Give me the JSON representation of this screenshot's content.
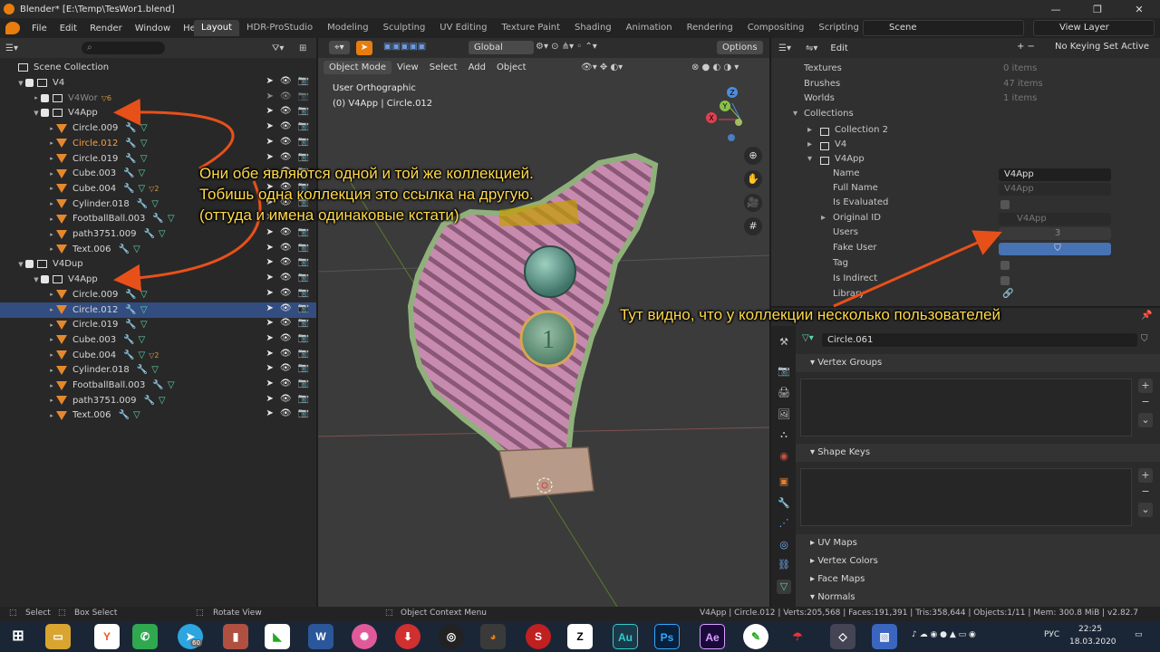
{
  "window": {
    "title": "Blender* [E:\\Temp\\TesWor1.blend]",
    "minimize": "—",
    "maximize": "❐",
    "close": "✕"
  },
  "menu": {
    "items": [
      "File",
      "Edit",
      "Render",
      "Window",
      "Help"
    ],
    "workspace_tabs": [
      "Layout",
      "HDR-ProStudio",
      "Modeling",
      "Sculpting",
      "UV Editing",
      "Texture Paint",
      "Shading",
      "Animation",
      "Rendering",
      "Compositing",
      "Scripting"
    ],
    "active_tab": "Layout",
    "scene": "Scene",
    "view_layer": "View Layer"
  },
  "outliner": {
    "root": "Scene Collection",
    "rows": [
      {
        "label": "V4",
        "depth": 0,
        "kind": "collection",
        "arrow": "▼"
      },
      {
        "label": "V4Wor",
        "depth": 1,
        "kind": "collection",
        "arrow": "▸",
        "dim": true,
        "badge": "6"
      },
      {
        "label": "V4App",
        "depth": 1,
        "kind": "collection",
        "arrow": "▼"
      },
      {
        "label": "Circle.009",
        "depth": 2,
        "kind": "object"
      },
      {
        "label": "Circle.012",
        "depth": 2,
        "kind": "object",
        "active": true
      },
      {
        "label": "Circle.019",
        "depth": 2,
        "kind": "object"
      },
      {
        "label": "Cube.003",
        "depth": 2,
        "kind": "object"
      },
      {
        "label": "Cube.004",
        "depth": 2,
        "kind": "object",
        "badge": "2"
      },
      {
        "label": "Cylinder.018",
        "depth": 2,
        "kind": "object"
      },
      {
        "label": "FootballBall.003",
        "depth": 2,
        "kind": "object"
      },
      {
        "label": "path3751.009",
        "depth": 2,
        "kind": "object"
      },
      {
        "label": "Text.006",
        "depth": 2,
        "kind": "object"
      },
      {
        "label": "V4Dup",
        "depth": 0,
        "kind": "collection",
        "arrow": "▼"
      },
      {
        "label": "V4App",
        "depth": 1,
        "kind": "collection",
        "arrow": "▼"
      },
      {
        "label": "Circle.009",
        "depth": 2,
        "kind": "object"
      },
      {
        "label": "Circle.012",
        "depth": 2,
        "kind": "object",
        "selected": true
      },
      {
        "label": "Circle.019",
        "depth": 2,
        "kind": "object"
      },
      {
        "label": "Cube.003",
        "depth": 2,
        "kind": "object"
      },
      {
        "label": "Cube.004",
        "depth": 2,
        "kind": "object",
        "badge": "2"
      },
      {
        "label": "Cylinder.018",
        "depth": 2,
        "kind": "object"
      },
      {
        "label": "FootballBall.003",
        "depth": 2,
        "kind": "object"
      },
      {
        "label": "path3751.009",
        "depth": 2,
        "kind": "object"
      },
      {
        "label": "Text.006",
        "depth": 2,
        "kind": "object"
      }
    ]
  },
  "viewport": {
    "transform": "Global",
    "options": "Options",
    "mode": "Object Mode",
    "menus": [
      "View",
      "Select",
      "Add",
      "Object"
    ],
    "view_name": "User Orthographic",
    "context": "(0) V4App | Circle.012",
    "axis_x": "X",
    "axis_y": "Y",
    "axis_z": "Z"
  },
  "props_top": {
    "edit": "Edit",
    "keying": "No Keying Set Active",
    "rows": [
      {
        "key": "Textures",
        "value": "0 items"
      },
      {
        "key": "Brushes",
        "value": "47 items"
      },
      {
        "key": "Worlds",
        "value": "1 items"
      },
      {
        "key": "Collections",
        "value": ""
      }
    ],
    "children": [
      "Collection 2",
      "V4",
      "V4App"
    ],
    "fields": {
      "name_label": "Name",
      "name_value": "V4App",
      "full_name_label": "Full Name",
      "full_name_value": "V4App",
      "evaluated_label": "Is Evaluated",
      "original_label": "Original ID",
      "original_value": "V4App",
      "users_label": "Users",
      "users_value": "3",
      "fake_label": "Fake User",
      "tag_label": "Tag",
      "indirect_label": "Is Indirect",
      "library_label": "Library"
    }
  },
  "props_bot": {
    "object_name": "Circle.061",
    "panels": {
      "vertex_groups": "Vertex Groups",
      "shape_keys": "Shape Keys",
      "uv_maps": "UV Maps",
      "vertex_colors": "Vertex Colors",
      "face_maps": "Face Maps",
      "normals": "Normals"
    }
  },
  "status": {
    "select": "Select",
    "box_select": "Box Select",
    "rotate": "Rotate View",
    "context_menu": "Object Context Menu",
    "stats": "V4App | Circle.012 | Verts:205,568 | Faces:191,391 | Tris:358,644 | Objects:1/11 | Mem: 300.8 MiB | v2.82.7"
  },
  "taskbar": {
    "telegram_badge": "60",
    "lang": "РУС",
    "time": "22:25",
    "date": "18.03.2020"
  },
  "annotations": {
    "line1": "Они обе являются одной и той же коллекцией.",
    "line2": "Тобишь одна коллекция это ссылка на другую.",
    "line3": "(оттуда и имена одинаковые кстати)",
    "users_note": "Тут видно, что у коллекции несколько пользователей",
    "color": "#ffd94a"
  }
}
